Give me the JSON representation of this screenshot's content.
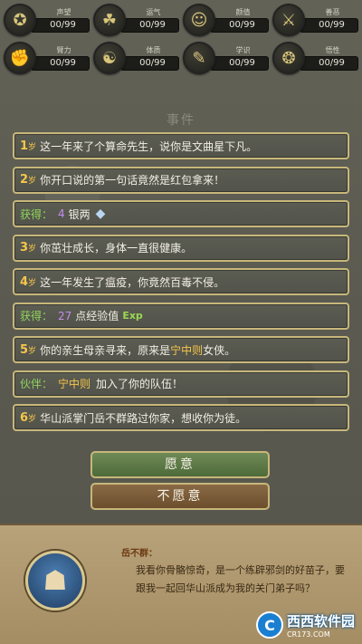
{
  "stats": [
    {
      "name": "声望",
      "value": "00/99",
      "icon": "medal-icon",
      "glyph": "✪"
    },
    {
      "name": "运气",
      "value": "00/99",
      "icon": "toad-icon",
      "glyph": "☘"
    },
    {
      "name": "颜值",
      "value": "00/99",
      "icon": "face-icon",
      "glyph": "☺"
    },
    {
      "name": "善恶",
      "value": "00/99",
      "icon": "crossed-swords-icon",
      "glyph": "⚔"
    },
    {
      "name": "臂力",
      "value": "00/99",
      "icon": "fist-icon",
      "glyph": "✊"
    },
    {
      "name": "体质",
      "value": "00/99",
      "icon": "meditation-icon",
      "glyph": "☯"
    },
    {
      "name": "学识",
      "value": "00/99",
      "icon": "book-icon",
      "glyph": "✎"
    },
    {
      "name": "悟性",
      "value": "00/99",
      "icon": "brain-icon",
      "glyph": "❂"
    }
  ],
  "panel_title": "事件",
  "events": [
    {
      "age": "1",
      "unit": "岁",
      "text": "这一年来了个算命先生，说你是文曲星下凡。"
    },
    {
      "age": "2",
      "unit": "岁",
      "text": "你开口说的第一句话竟然是红包拿来！"
    },
    {
      "gain_label": "获得：",
      "num": "4",
      "text": "银两",
      "icon": "silver-ingot-icon",
      "glyph": "◆"
    },
    {
      "age": "3",
      "unit": "岁",
      "text": "你茁壮成长，身体一直很健康。"
    },
    {
      "age": "4",
      "unit": "岁",
      "text": "这一年发生了瘟疫，你竟然百毒不侵。"
    },
    {
      "gain_label": "获得：",
      "num": "27",
      "text": "点经验值",
      "icon": "exp-icon",
      "glyph": "Exp"
    },
    {
      "age": "5",
      "unit": "岁",
      "text_before": "你的亲生母亲寻来，原来是",
      "highlight": "宁中则",
      "text_after": "女侠。"
    },
    {
      "ally_label": "伙伴：",
      "highlight": "宁中则",
      "text": "加入了你的队伍！"
    },
    {
      "age": "6",
      "unit": "岁",
      "text": "华山派掌门岳不群路过你家，想收你为徒。"
    }
  ],
  "buttons": {
    "accept": "愿意",
    "decline": "不愿意"
  },
  "dialog": {
    "speaker": "岳不群：",
    "text": "我看你骨骼惊奇，是一个练辟邪剑的好苗子，要跟我一起回华山派成为我的关门弟子吗？",
    "portrait_icon": "swordsman-portrait-icon"
  },
  "watermark": {
    "logo": "C",
    "text": "西西软件园",
    "sub": "CR173.COM"
  }
}
